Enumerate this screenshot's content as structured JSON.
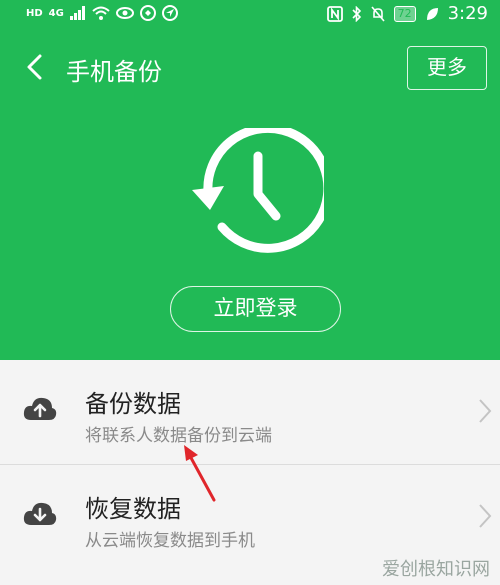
{
  "status_bar": {
    "left_network": "HD",
    "left_net_type": "4G",
    "right_battery": "72",
    "right_time": "3:29"
  },
  "nav": {
    "back_icon": "chevron-left-icon",
    "title": "手机备份",
    "more_label": "更多"
  },
  "hero": {
    "icon": "history-clock-icon",
    "login_label": "立即登录"
  },
  "list": {
    "items": [
      {
        "icon": "cloud-upload-icon",
        "title": "备份数据",
        "subtitle": "将联系人数据备份到云端"
      },
      {
        "icon": "cloud-download-icon",
        "title": "恢复数据",
        "subtitle": "从云端恢复数据到手机"
      }
    ]
  },
  "watermark": "爱创根知识网",
  "colors": {
    "header": "#21ba56",
    "annotation_arrow": "#e0262b"
  }
}
